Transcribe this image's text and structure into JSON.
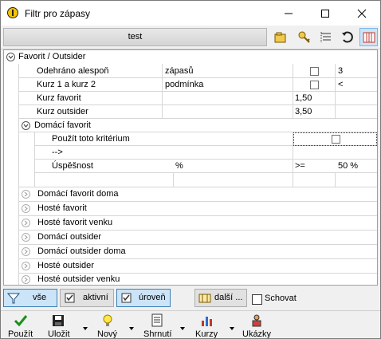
{
  "window": {
    "title": "Filtr pro zápasy"
  },
  "toolbar": {
    "test_label": "test",
    "icons": [
      "folder-open-icon",
      "key-icon",
      "list-icon",
      "refresh-icon",
      "columns-icon"
    ]
  },
  "tree": {
    "root": {
      "label": "Favorit / Outsider"
    },
    "rows": [
      {
        "label": "Odehráno alespoň",
        "col2": "zápasů",
        "value": "3",
        "checked": false
      },
      {
        "label": "Kurz 1 a kurz 2",
        "col2": "podmínka",
        "value": "<",
        "checked": false
      },
      {
        "label": "Kurz favorit",
        "value": "1,50"
      },
      {
        "label": "Kurz outsider",
        "value": "3,50"
      }
    ],
    "domaci_favorit": {
      "label": "Domácí favorit",
      "use_label": "Použít toto kritérium",
      "arrow_label": "-->",
      "success_label": "Úspěšnost",
      "success_unit": "%",
      "success_op": ">=",
      "success_value": "50 %"
    },
    "collapsed_groups": [
      "Domácí favorit doma",
      "Hosté favorit",
      "Hosté favorit venku",
      "Domácí outsider",
      "Domácí outsider doma",
      "Hosté outsider",
      "Hosté outsider venku"
    ]
  },
  "filterbar": {
    "vse": "vše",
    "aktivni": "aktivní",
    "uroven": "úroveň",
    "dalsi": "další ...",
    "schovat": "Schovat"
  },
  "bottombar": {
    "pouzit": "Použít",
    "ulozit": "Uložit",
    "novy": "Nový",
    "shrnuti": "Shrnutí",
    "kurzy": "Kurzy",
    "ukazky": "Ukázky"
  },
  "colors": {
    "accent_pressed": "#cce4f7",
    "grid": "#d6d6d6"
  }
}
